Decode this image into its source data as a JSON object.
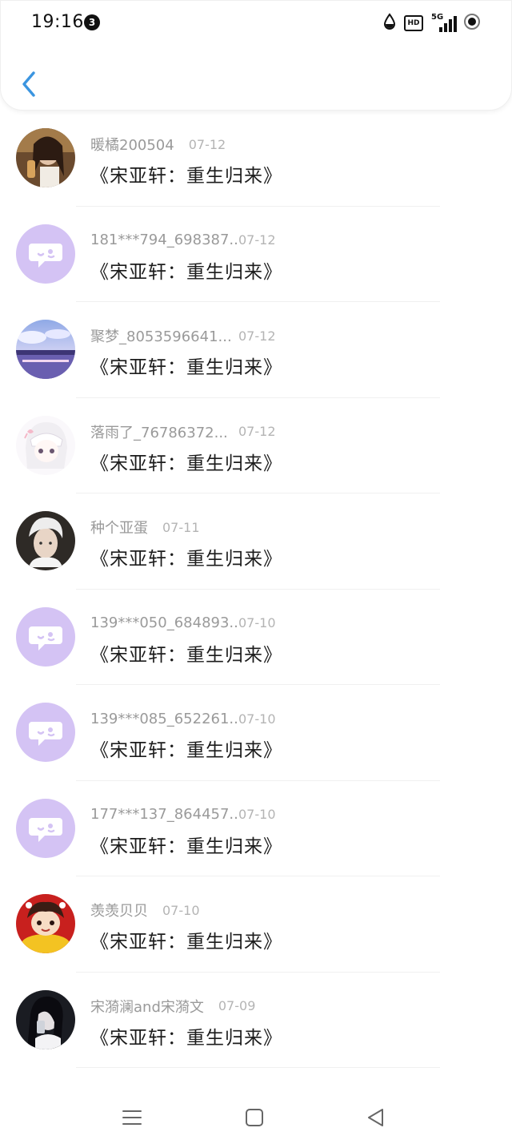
{
  "status_bar": {
    "time": "19:16",
    "notification_count": "3",
    "hd_label": "HD",
    "network_label": "5G"
  },
  "accent_color": "#3b95e0",
  "default_avatar_color": "#d4c3f4",
  "list": {
    "rows": [
      {
        "name": "暖橘200504",
        "date": "07-12",
        "title": "《宋亚轩：重生归来》"
      },
      {
        "name": "181***794_698387...",
        "date": "07-12",
        "title": "《宋亚轩：重生归来》"
      },
      {
        "name": "聚梦_8053596641...",
        "date": "07-12",
        "title": "《宋亚轩：重生归来》"
      },
      {
        "name": "落雨了_76786372...",
        "date": "07-12",
        "title": "《宋亚轩：重生归来》"
      },
      {
        "name": "种个亚蛋",
        "date": "07-11",
        "title": "《宋亚轩：重生归来》"
      },
      {
        "name": "139***050_684893...",
        "date": "07-10",
        "title": "《宋亚轩：重生归来》"
      },
      {
        "name": "139***085_652261...",
        "date": "07-10",
        "title": "《宋亚轩：重生归来》"
      },
      {
        "name": "177***137_864457...",
        "date": "07-10",
        "title": "《宋亚轩：重生归来》"
      },
      {
        "name": "羡羡贝贝",
        "date": "07-10",
        "title": "《宋亚轩：重生归来》"
      },
      {
        "name": "宋漪澜and宋漪文",
        "date": "07-09",
        "title": "《宋亚轩：重生归来》"
      }
    ]
  }
}
